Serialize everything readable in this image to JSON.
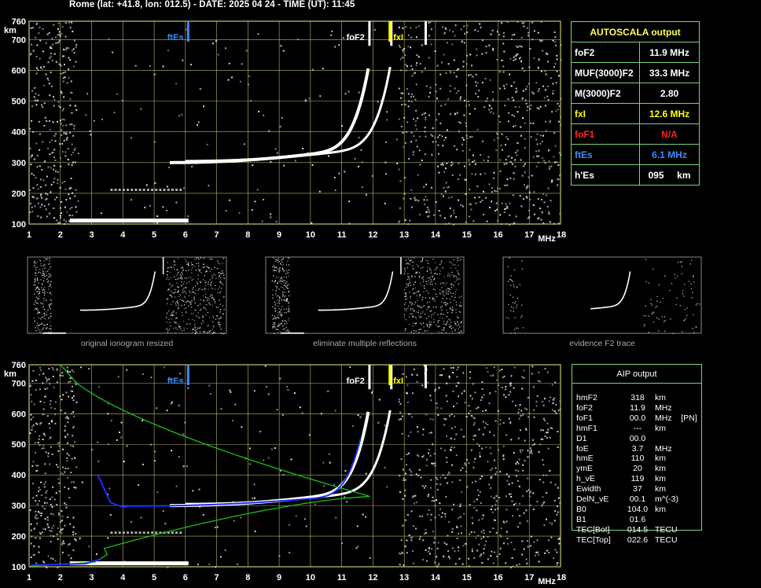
{
  "header": "Rome (lat: +41.8, lon: 012.5) - DATE: 2025 04 24 - TIME (UT): 11:45",
  "colors": {
    "grid": "#d8d87a",
    "frame": "#c8c870",
    "fxi": "#ffff00",
    "ftes": "#3a8cff",
    "fof1": "#ff2222",
    "table_border": "#7cd37c",
    "profile_green": "#19c019",
    "profile_blue": "#1a2cff"
  },
  "axes": {
    "x_ticks": [
      "1",
      "2",
      "3",
      "4",
      "5",
      "6",
      "7",
      "8",
      "9",
      "10",
      "11",
      "12",
      "13",
      "14",
      "15",
      "16",
      "17",
      "18"
    ],
    "x_unit": "MHz",
    "y_ticks": [
      "100",
      "200",
      "300",
      "400",
      "500",
      "600",
      "700",
      "760"
    ],
    "y_unit": "km"
  },
  "markers": {
    "ftes": "ftEs",
    "fof2": "foF2",
    "fxi": "fxI"
  },
  "thumb_captions": [
    "original ionogram resized",
    "eliminate multiple reflections",
    "evidence F2 trace"
  ],
  "autoscala": {
    "title": "AUTOSCALA output",
    "rows": [
      {
        "label": "foF2",
        "value": "11.9 MHz",
        "color": "#ffffff"
      },
      {
        "label": "MUF(3000)F2",
        "value": "33.3 MHz",
        "color": "#ffffff"
      },
      {
        "label": "M(3000)F2",
        "value": "2.80",
        "color": "#ffffff"
      },
      {
        "label": "fxI",
        "value": "12.6 MHz",
        "color": "#ffff00"
      },
      {
        "label": "foF1",
        "value": "N/A",
        "color": "#ff2222"
      },
      {
        "label": "ftEs",
        "value": "6.1 MHz",
        "color": "#3a8cff"
      },
      {
        "label": "h'Es",
        "value": "095     km",
        "color": "#ffffff"
      }
    ]
  },
  "aip": {
    "title": "AIP output",
    "rows": [
      [
        "hmF2",
        "318",
        "km"
      ],
      [
        "foF2",
        "11.9",
        "MHz"
      ],
      [
        "foF1",
        "00.0",
        "MHz    [PN]"
      ],
      [
        "hmF1",
        "---",
        "km"
      ],
      [
        "D1",
        "00.0",
        ""
      ],
      [
        "foE",
        "3.7",
        "MHz"
      ],
      [
        "hmE",
        "110",
        "km"
      ],
      [
        "ymE",
        "20",
        "km"
      ],
      [
        "h_vE",
        "119",
        "km"
      ],
      [
        "Ewidth",
        "37",
        "km"
      ],
      [
        "DelN_vE",
        "00.1",
        "m^(-3)"
      ],
      [
        "B0",
        "104.0",
        "km"
      ],
      [
        "B1",
        "01.6",
        ""
      ],
      [
        "TEC[Bot]",
        "014.5",
        "TECU"
      ],
      [
        "TEC[Top]",
        "022.6",
        "TECU"
      ]
    ]
  }
}
